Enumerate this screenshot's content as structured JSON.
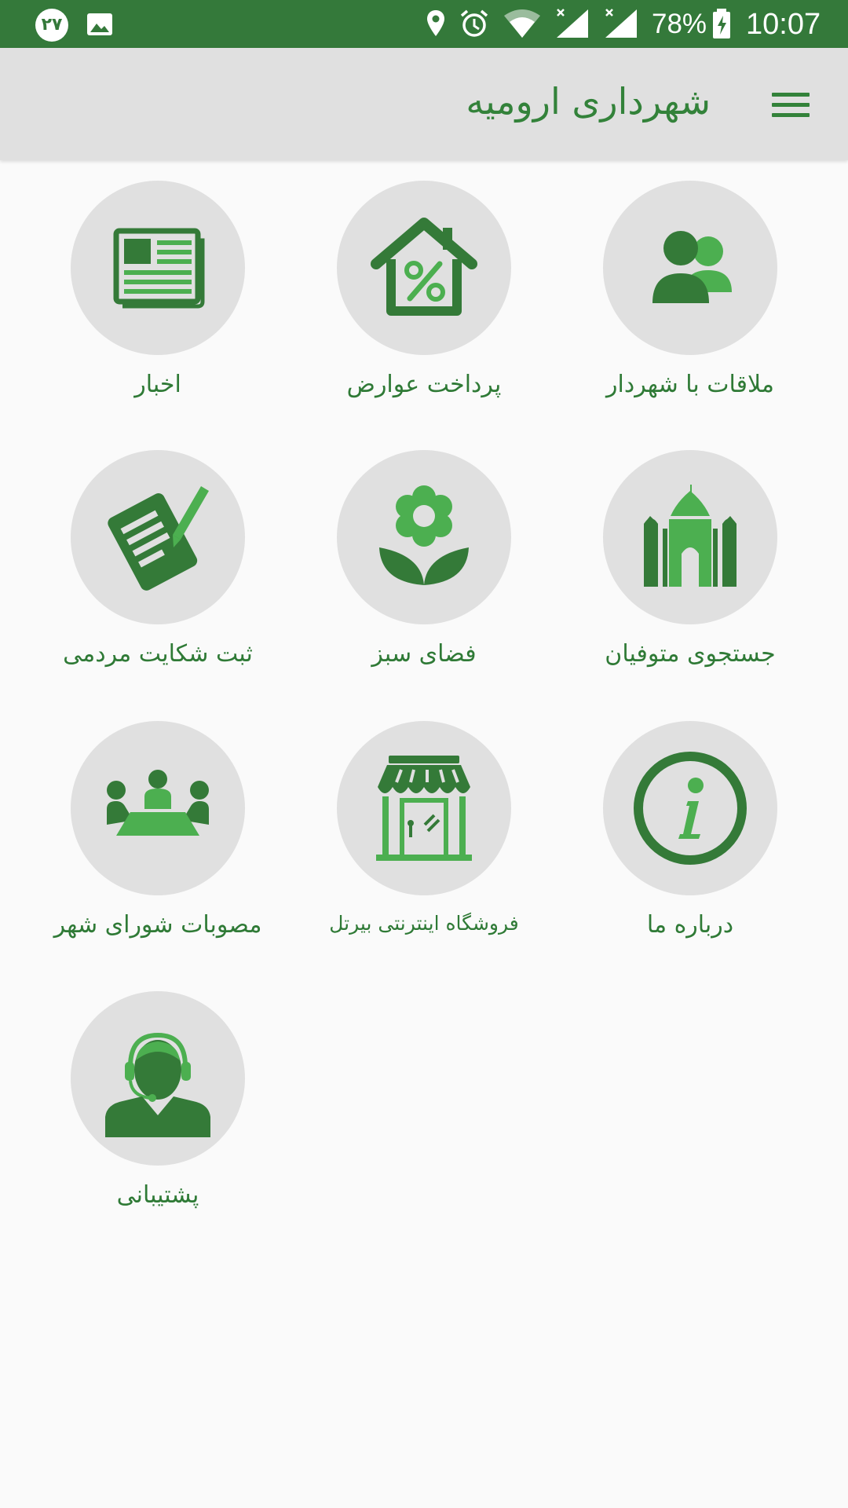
{
  "status_bar": {
    "notification_badge": "۲۷",
    "battery_percent": "78%",
    "time": "10:07",
    "icons": [
      "image-icon",
      "location-icon",
      "alarm-icon",
      "wifi-icon",
      "signal-icon",
      "signal-icon",
      "battery-charging-icon"
    ]
  },
  "app_bar": {
    "title": "شهرداری ارومیه",
    "menu_icon": "hamburger-menu-icon"
  },
  "colors": {
    "primary": "#34793a",
    "dark_green": "#347a38",
    "light_green": "#4caf50",
    "circle_bg": "#e0e0e0",
    "app_bar_bg": "#e0e0e0"
  },
  "menu": {
    "items": [
      {
        "label": "ملاقات با شهردار",
        "icon": "users-icon"
      },
      {
        "label": "پرداخت عوارض",
        "icon": "house-percent-icon"
      },
      {
        "label": "اخبار",
        "icon": "newspaper-icon"
      },
      {
        "label": "جستجوی متوفیان",
        "icon": "mosque-icon"
      },
      {
        "label": "فضای سبز",
        "icon": "flower-icon"
      },
      {
        "label": "ثبت شکایت مردمی",
        "icon": "document-pen-icon"
      },
      {
        "label": "درباره ما",
        "icon": "info-icon"
      },
      {
        "label": "فروشگاه اینترنتی بیرتل",
        "icon": "storefront-icon"
      },
      {
        "label": "مصوبات شورای شهر",
        "icon": "council-meeting-icon"
      },
      {
        "label": "پشتیبانی",
        "icon": "support-headset-icon"
      }
    ]
  }
}
